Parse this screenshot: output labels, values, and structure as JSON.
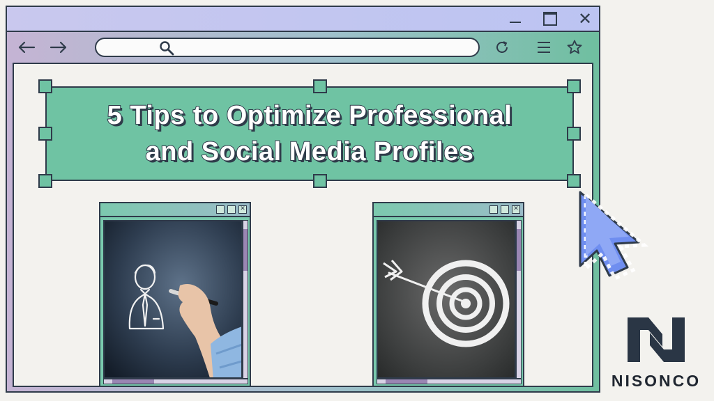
{
  "banner": {
    "line1": "5 Tips to Optimize Professional",
    "line2": "and Social Media Profiles"
  },
  "brand": {
    "name": "NISONCO"
  },
  "colors": {
    "accent_green": "#6fc3a3",
    "outline": "#2f3b4a",
    "cursor_blue": "#6f8ef0",
    "titlebar": "#bcc4f2"
  },
  "icons": {
    "window": [
      "minimize-icon",
      "maximize-icon",
      "close-icon"
    ],
    "toolbar": [
      "back-arrow-icon",
      "forward-arrow-icon",
      "search-icon",
      "reload-icon",
      "menu-icon",
      "star-icon"
    ],
    "mini_window": [
      "minimize-icon",
      "maximize-icon",
      "close-icon"
    ]
  }
}
